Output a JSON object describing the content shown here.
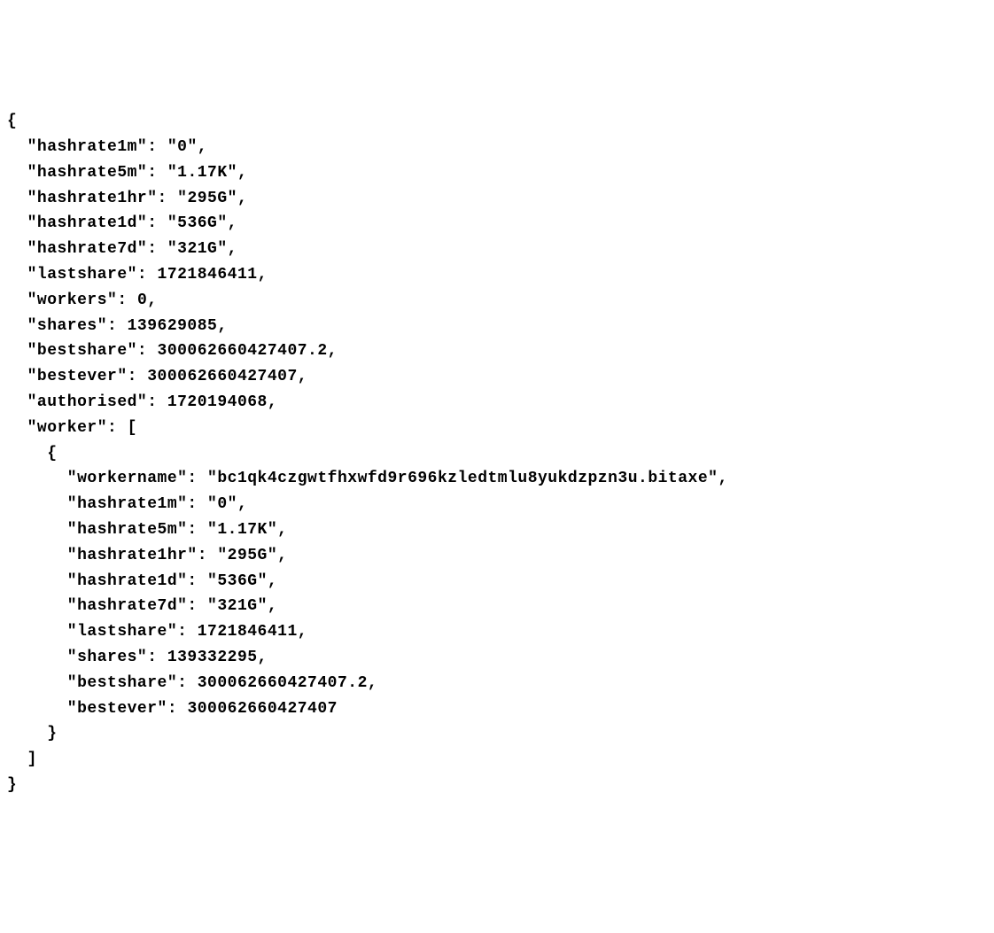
{
  "stats": {
    "hashrate1m": "0",
    "hashrate5m": "1.17K",
    "hashrate1hr": "295G",
    "hashrate1d": "536G",
    "hashrate7d": "321G",
    "lastshare": 1721846411,
    "workers": 0,
    "shares": 139629085,
    "bestshare": "300062660427407.2",
    "bestever": 300062660427407,
    "authorised": 1720194068
  },
  "worker": {
    "workername": "bc1qk4czgwtfhxwfd9r696kzledtmlu8yukdzpzn3u.bitaxe",
    "hashrate1m": "0",
    "hashrate5m": "1.17K",
    "hashrate1hr": "295G",
    "hashrate1d": "536G",
    "hashrate7d": "321G",
    "lastshare": 1721846411,
    "shares": 139332295,
    "bestshare": "300062660427407.2",
    "bestever": 300062660427407
  }
}
